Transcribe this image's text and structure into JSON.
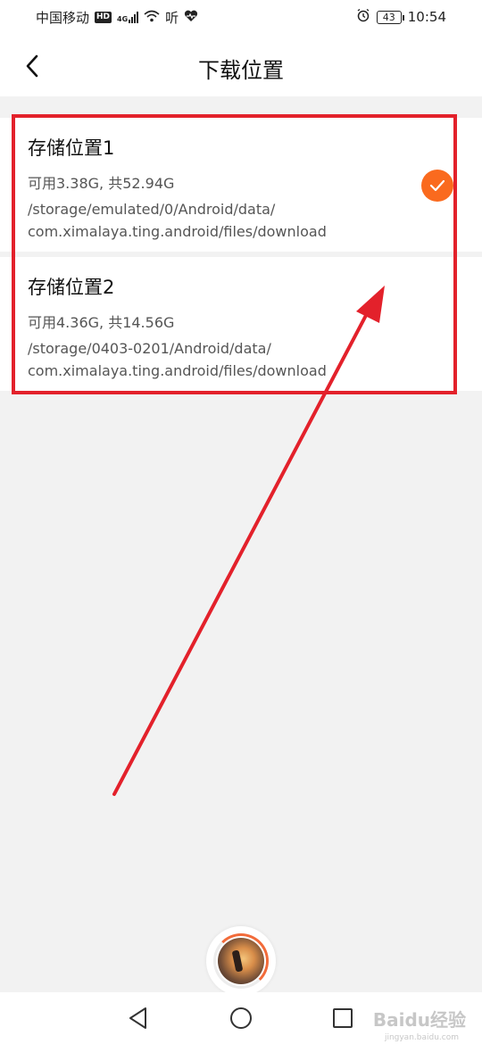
{
  "status_bar": {
    "carrier": "中国移动",
    "hd_badge": "HD",
    "network": "4G",
    "extra_icon_text": "听",
    "battery": "43",
    "time": "10:54"
  },
  "header": {
    "title": "下载位置"
  },
  "storage_list": [
    {
      "name": "存储位置1",
      "space": "可用3.38G, 共52.94G",
      "path_line1": "/storage/emulated/0/Android/data/",
      "path_line2": "com.ximalaya.ting.android/files/download",
      "selected": true
    },
    {
      "name": "存储位置2",
      "space": "可用4.36G, 共14.56G",
      "path_line1": "/storage/0403-0201/Android/data/",
      "path_line2": "com.ximalaya.ting.android/files/download",
      "selected": false
    }
  ],
  "watermark": {
    "text": "Baidu经验",
    "sub": "jingyan.baidu.com"
  },
  "colors": {
    "accent": "#fa6a1e",
    "annotation": "#e3212b"
  },
  "icons": {
    "back": "chevron-left-icon",
    "check": "check-icon",
    "nav_back": "triangle-back-icon",
    "nav_home": "circle-home-icon",
    "nav_recent": "square-recent-icon"
  }
}
